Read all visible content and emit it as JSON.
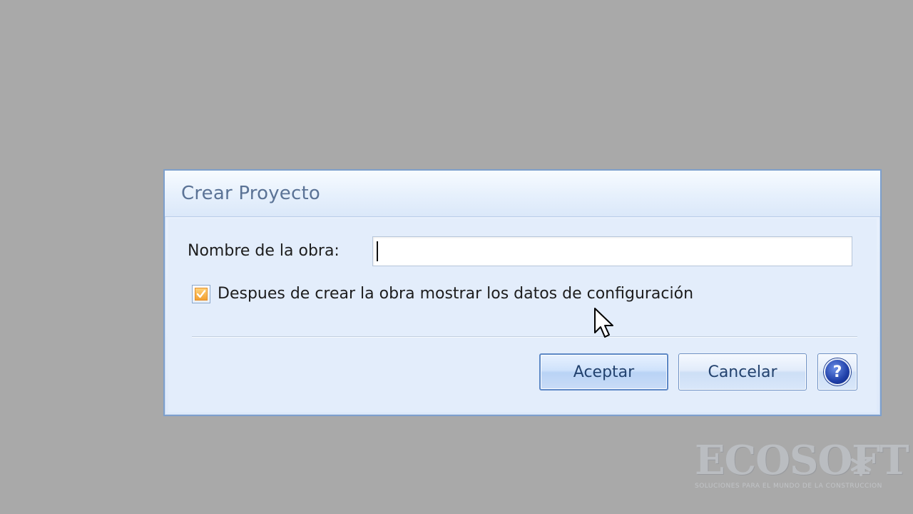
{
  "dialog": {
    "title": "Crear Proyecto",
    "name_label": "Nombre de la obra:",
    "name_value": "",
    "checkbox": {
      "checked": true,
      "label": "Despues de crear la obra mostrar los datos de configuración"
    },
    "buttons": {
      "accept": "Aceptar",
      "cancel": "Cancelar",
      "help_icon": "help-question-icon"
    }
  },
  "watermark": {
    "brand": "ECOSOFT",
    "tagline": "SOLUCIONES PARA EL MUNDO DE LA CONSTRUCCION"
  },
  "colors": {
    "background": "#a9a9a9",
    "dialog_border": "#7d9fcc",
    "title_text": "#5b7396",
    "checkbox_accent": "#f2a032",
    "help_icon": "#1f3fa8"
  }
}
